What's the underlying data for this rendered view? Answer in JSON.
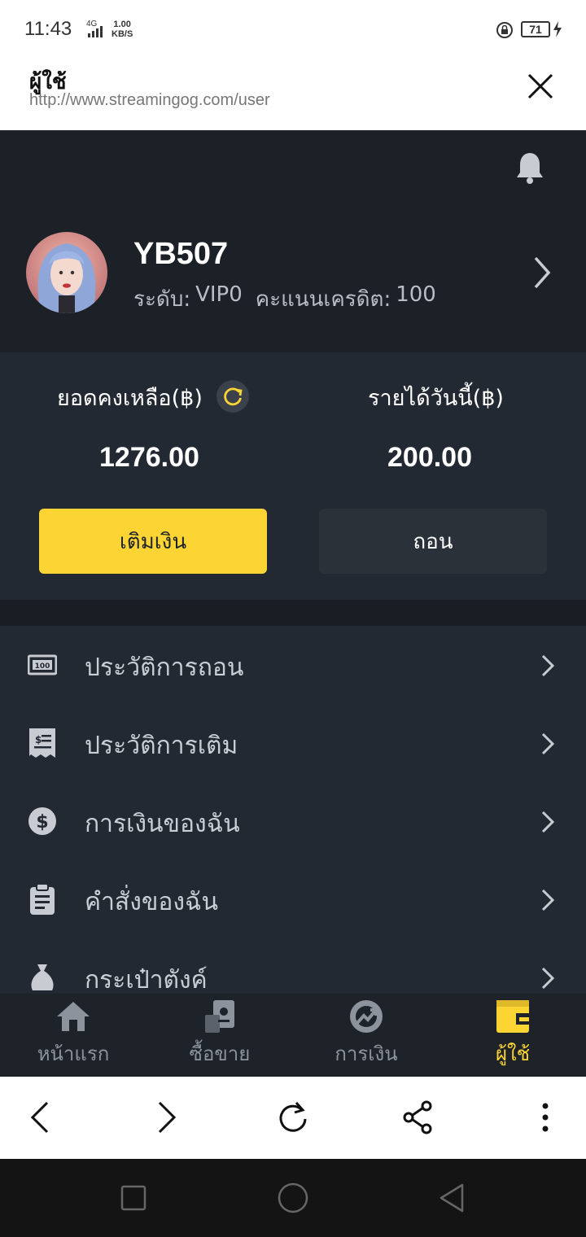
{
  "status_bar": {
    "time": "11:43",
    "network": "4G",
    "speed_value": "1.00",
    "speed_unit": "KB/S",
    "battery": "71"
  },
  "browser": {
    "title": "ผู้ใช้",
    "url": "http://www.streamingog.com/user"
  },
  "profile": {
    "username": "YB507",
    "level_label": "ระดับ:",
    "level_value": "VIP0",
    "credit_label": "คะแนนเครดิต:",
    "credit_value": "100"
  },
  "wallet": {
    "balance_label": "ยอดคงเหลือ(฿)",
    "balance_value": "1276.00",
    "income_label": "รายได้วันนี้(฿)",
    "income_value": "200.00",
    "deposit_label": "เติมเงิน",
    "withdraw_label": "ถอน"
  },
  "menu": {
    "items": [
      {
        "label": "ประวัติการถอน",
        "icon": "banknote-100-icon"
      },
      {
        "label": "ประวัติการเติม",
        "icon": "receipt-icon"
      },
      {
        "label": "การเงินของฉัน",
        "icon": "dollar-circle-icon"
      },
      {
        "label": "คำสั่งของฉัน",
        "icon": "clipboard-icon"
      },
      {
        "label": "กระเป๋าตังค์",
        "icon": "money-bag-icon"
      }
    ]
  },
  "tabbar": {
    "tabs": [
      {
        "label": "หน้าแรก",
        "icon": "home-icon"
      },
      {
        "label": "ซื้อขาย",
        "icon": "trade-icon"
      },
      {
        "label": "การเงิน",
        "icon": "finance-icon"
      },
      {
        "label": "ผู้ใช้",
        "icon": "wallet-icon",
        "active": true
      }
    ]
  },
  "colors": {
    "accent": "#fcd535",
    "background": "#1e232a",
    "panel": "#232932"
  }
}
